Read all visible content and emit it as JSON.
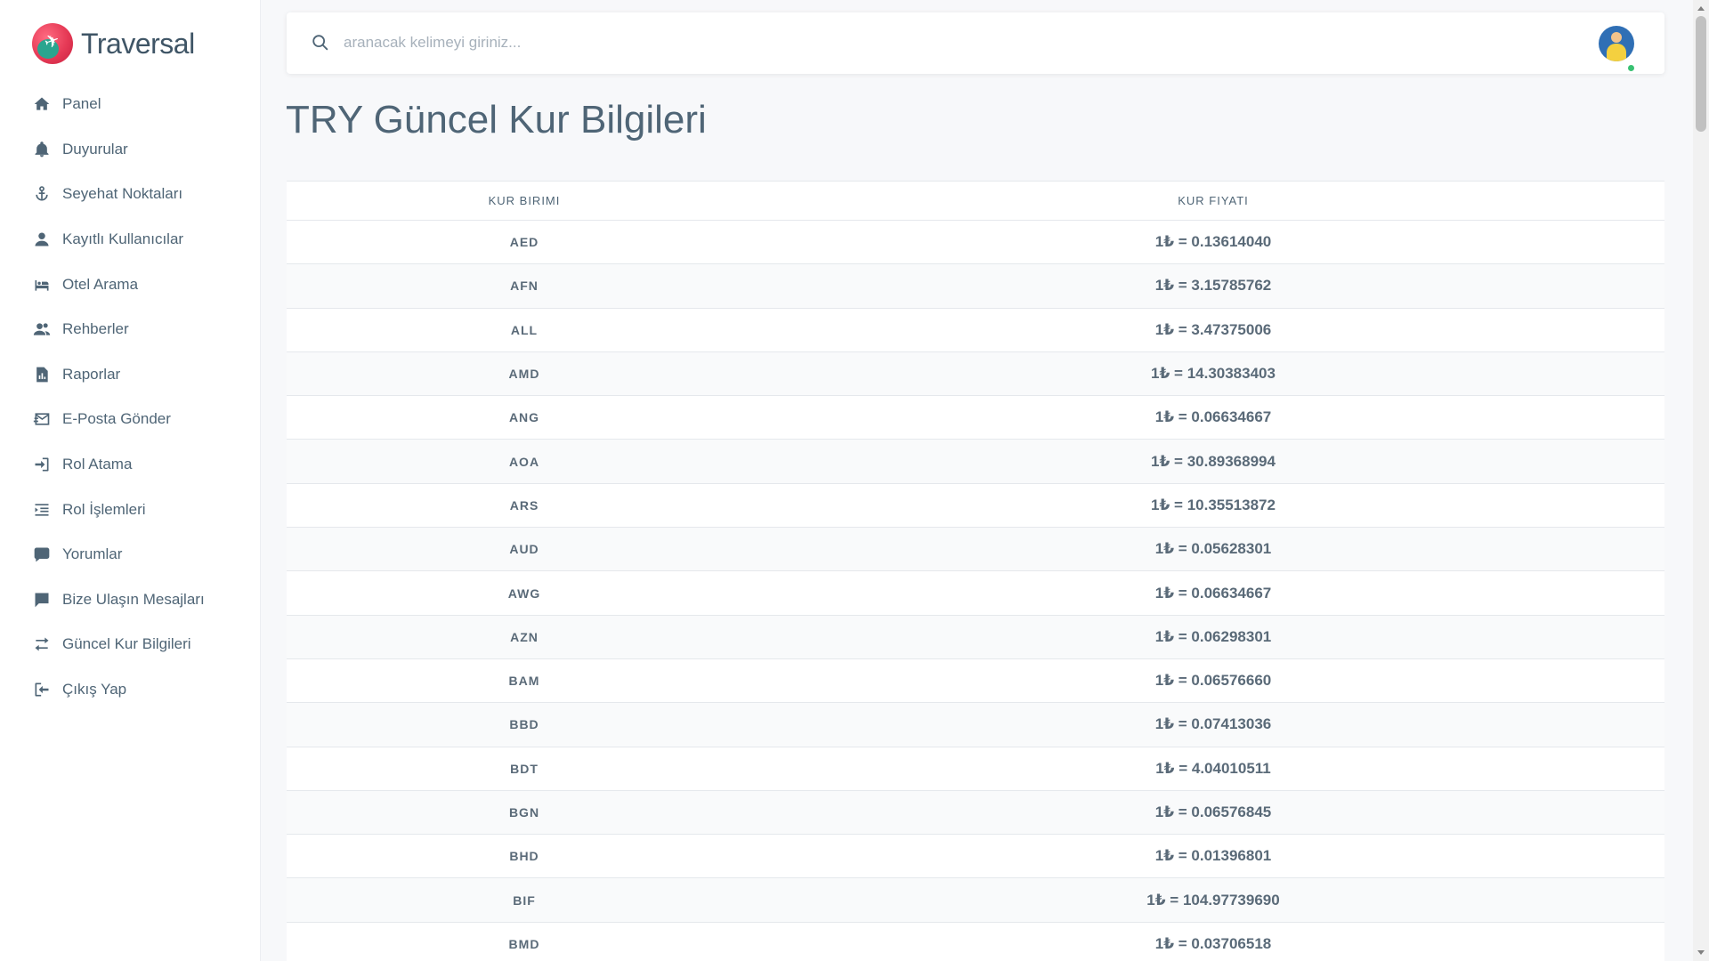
{
  "brand": {
    "name": "Traversal"
  },
  "sidebar": {
    "items": [
      {
        "label": "Panel",
        "icon": "home-icon"
      },
      {
        "label": "Duyurular",
        "icon": "bell-icon"
      },
      {
        "label": "Seyehat Noktaları",
        "icon": "anchor-icon"
      },
      {
        "label": "Kayıtlı Kullanıcılar",
        "icon": "user-icon"
      },
      {
        "label": "Otel Arama",
        "icon": "bed-icon"
      },
      {
        "label": "Rehberler",
        "icon": "users-icon"
      },
      {
        "label": "Raporlar",
        "icon": "report-icon"
      },
      {
        "label": "E-Posta Gönder",
        "icon": "mail-send-icon"
      },
      {
        "label": "Rol Atama",
        "icon": "login-icon"
      },
      {
        "label": "Rol İşlemleri",
        "icon": "list-indent-icon"
      },
      {
        "label": "Yorumlar",
        "icon": "comment-icon"
      },
      {
        "label": "Bize Ulaşın Mesajları",
        "icon": "message-icon"
      },
      {
        "label": "Güncel Kur Bilgileri",
        "icon": "exchange-icon"
      },
      {
        "label": "Çıkış Yap",
        "icon": "logout-icon"
      }
    ]
  },
  "search": {
    "placeholder": "aranacak kelimeyi giriniz..."
  },
  "page": {
    "title": "TRY Güncel Kur Bilgileri"
  },
  "table": {
    "headers": {
      "currency": "KUR BIRIMI",
      "rate": "KUR FIYATI"
    },
    "rows": [
      {
        "code": "AED",
        "rate": "1₺ = 0.13614040"
      },
      {
        "code": "AFN",
        "rate": "1₺ = 3.15785762"
      },
      {
        "code": "ALL",
        "rate": "1₺ = 3.47375006"
      },
      {
        "code": "AMD",
        "rate": "1₺ = 14.30383403"
      },
      {
        "code": "ANG",
        "rate": "1₺ = 0.06634667"
      },
      {
        "code": "AOA",
        "rate": "1₺ = 30.89368994"
      },
      {
        "code": "ARS",
        "rate": "1₺ = 10.35513872"
      },
      {
        "code": "AUD",
        "rate": "1₺ = 0.05628301"
      },
      {
        "code": "AWG",
        "rate": "1₺ = 0.06634667"
      },
      {
        "code": "AZN",
        "rate": "1₺ = 0.06298301"
      },
      {
        "code": "BAM",
        "rate": "1₺ = 0.06576660"
      },
      {
        "code": "BBD",
        "rate": "1₺ = 0.07413036"
      },
      {
        "code": "BDT",
        "rate": "1₺ = 4.04010511"
      },
      {
        "code": "BGN",
        "rate": "1₺ = 0.06576845"
      },
      {
        "code": "BHD",
        "rate": "1₺ = 0.01396801"
      },
      {
        "code": "BIF",
        "rate": "1₺ = 104.97739690"
      },
      {
        "code": "BMD",
        "rate": "1₺ = 0.03706518"
      }
    ]
  },
  "colors": {
    "text": "#4f6576",
    "online": "#38c172",
    "brand": "#e63a56"
  }
}
